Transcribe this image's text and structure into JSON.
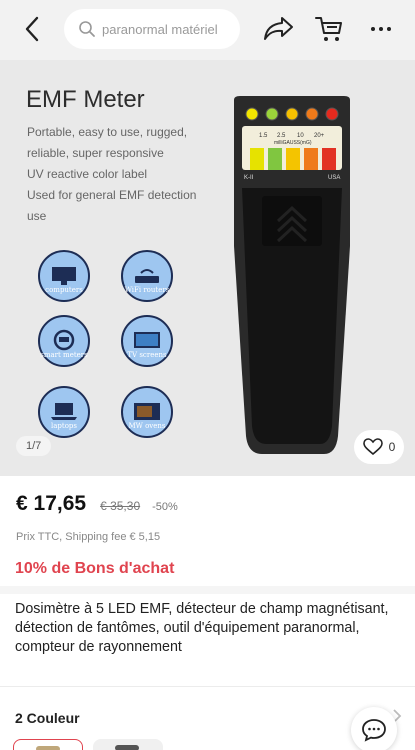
{
  "header": {
    "search_placeholder": "paranormal matériel"
  },
  "gallery": {
    "title": "EMF Meter",
    "description_lines": [
      "Portable, easy to use, rugged,",
      "reliable, super responsive",
      "UV reactive color label",
      "Used for general EMF detection",
      "use"
    ],
    "features": [
      "computers",
      "WiFi routers",
      "smart meters",
      "TV screens",
      "laptops",
      "MW ovens"
    ],
    "device": {
      "scale_labels": [
        "1.5",
        "2.5",
        "10",
        "20+"
      ],
      "unit_label": "milliGAUSS(mG)",
      "model_label": "K-II",
      "origin_label": "USA",
      "led_colors": [
        "#f2e600",
        "#9bd43a",
        "#f5c000",
        "#f07a1a",
        "#e52a1e"
      ]
    },
    "counter": "1/7",
    "favorites_count": "0"
  },
  "pricing": {
    "price": "€ 17,65",
    "original_price": "€ 35,30",
    "discount": "-50%",
    "tax_shipping": "Prix TTC, Shipping fee € 5,15",
    "coupon": "10% de Bons d'achat"
  },
  "product": {
    "title": "Dosimètre à 5 LED EMF, détecteur de champ magnétisant, détection de fantômes, outil d'équipement paranormal, compteur de rayonnement"
  },
  "variants": {
    "colors_label": "2 Couleur"
  },
  "colors": {
    "accent_red": "#e0444f",
    "header_bg": "#f2f2f2"
  }
}
